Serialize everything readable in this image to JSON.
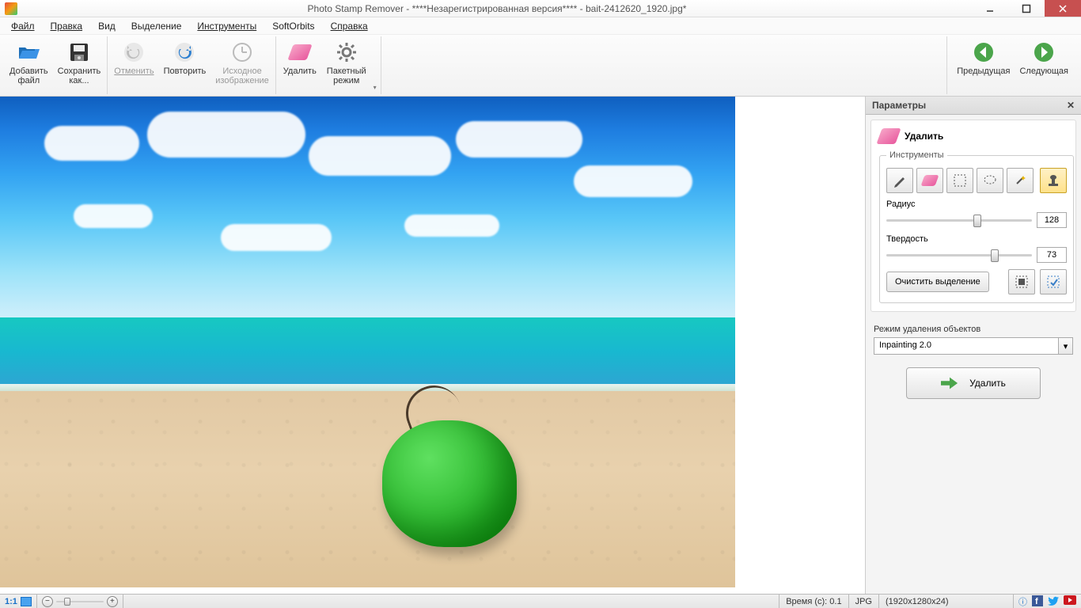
{
  "titlebar": {
    "title": "Photo Stamp Remover - ****Незарегистрированная версия**** - bait-2412620_1920.jpg*"
  },
  "menubar": {
    "file": "Файл",
    "edit": "Правка",
    "view": "Вид",
    "selection": "Выделение",
    "tools": "Инструменты",
    "softorbits": "SoftOrbits",
    "help": "Справка"
  },
  "toolbar": {
    "add_file": "Добавить\nфайл",
    "save_as": "Сохранить\nкак...",
    "undo": "Отменить",
    "redo": "Повторить",
    "original": "Исходное\nизображение",
    "delete": "Удалить",
    "batch": "Пакетный\nрежим",
    "prev": "Предыдущая",
    "next": "Следующая"
  },
  "panel": {
    "title": "Параметры",
    "remove_title": "Удалить",
    "tools_label": "Инструменты",
    "radius_label": "Радиус",
    "radius_value": "128",
    "hardness_label": "Твердость",
    "hardness_value": "73",
    "clear_selection": "Очистить выделение",
    "mode_label": "Режим удаления объектов",
    "mode_value": "Inpainting 2.0",
    "remove_button": "Удалить"
  },
  "statusbar": {
    "zoom": "1:1",
    "time": "Время (с): 0.1",
    "format": "JPG",
    "dims": "(1920x1280x24)"
  }
}
